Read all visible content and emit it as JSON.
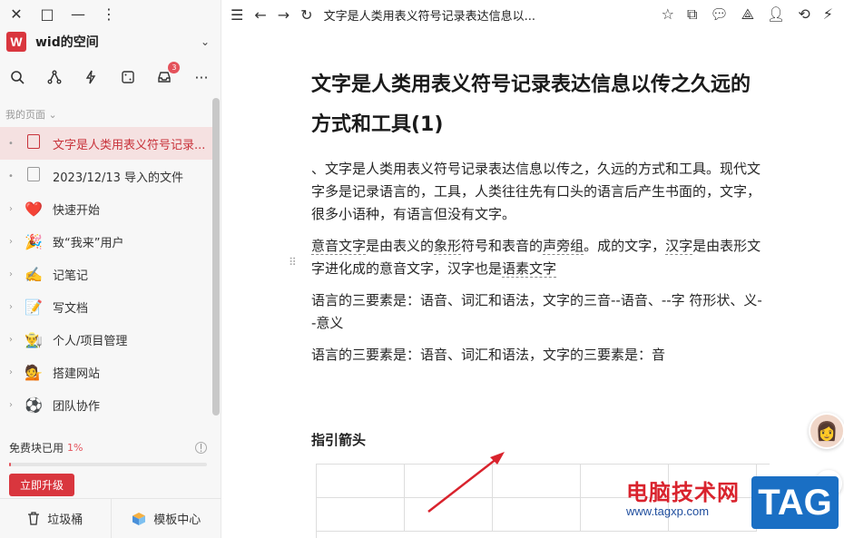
{
  "window": {
    "close": "✕",
    "maximize": "□",
    "minimize": "—",
    "more": "⋮"
  },
  "space": {
    "logo": "W",
    "name": "wid的空间"
  },
  "toolbar": {
    "inbox_badge": "3"
  },
  "sidebar": {
    "section_label": "我的页面",
    "items": [
      {
        "icon": "doc-icon",
        "label": "文字是人类用表义符号记录...",
        "active": true
      },
      {
        "icon": "doc-icon",
        "label": "2023/12/13 导入的文件"
      },
      {
        "icon": "heart-icon",
        "glyph": "❤️",
        "label": "快速开始"
      },
      {
        "icon": "party-popper-icon",
        "glyph": "🎉",
        "label": "致“我来”用户"
      },
      {
        "icon": "writing-hand-icon",
        "glyph": "✍️",
        "label": "记笔记"
      },
      {
        "icon": "document-icon",
        "glyph": "📝",
        "label": "写文档"
      },
      {
        "icon": "farmer-icon",
        "glyph": "👨‍🌾",
        "label": "个人/项目管理"
      },
      {
        "icon": "woman-icon",
        "glyph": "💁",
        "label": "搭建网站"
      },
      {
        "icon": "soccer-ball-icon",
        "glyph": "⚽",
        "label": "团队协作"
      }
    ]
  },
  "quota": {
    "label": "免费块已用",
    "percent": "1%",
    "fill_fraction": 0.01,
    "upgrade_label": "立即升级"
  },
  "bottom": {
    "trash": "垃圾桶",
    "templates": "模板中心"
  },
  "topbar": {
    "title": "文字是人类用表义符号记录表达信息以..."
  },
  "document": {
    "title": "文字是人类用表义符号记录表达信息以传之久远的方式和工具(1)",
    "p1": "、文字是人类用表义符号记录表达信息以传之，久远的方式和工具。现代文字多是记录语言的，工具，人类往往先有口头的语言后产生书面的，文字，很多小语种，有语言但没有文字。",
    "p2_parts": [
      "意音文字",
      "是由表义的",
      "象形",
      "符号和表音的",
      "声旁组",
      "。成的文字，",
      "汉字",
      "是由表形文字进化成的意音文字，汉字也是",
      "语素文字"
    ],
    "p3": "语言的三要素是：语音、词汇和语法，文字的三音--语音、--字 符形状、义--意义",
    "p4": "语言的三要素是：语音、词汇和语法，文字的三要素是：音",
    "heading": "指引箭头"
  },
  "watermark": {
    "site": "电脑技术网",
    "url": "www.tagxp.com",
    "tag": "TAG"
  },
  "colors": {
    "accent": "#d9363e",
    "active_bg": "#f5e1e1",
    "arrow": "#d9232d"
  }
}
